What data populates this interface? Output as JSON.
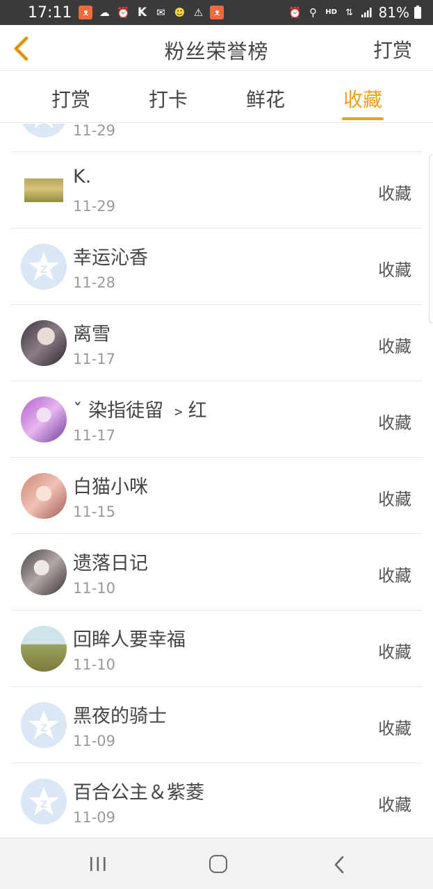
{
  "status_bar": {
    "time": "17:11",
    "battery_percent": "81%",
    "left_icons": [
      "app-notification-icon",
      "weather-icon",
      "alarm-icon",
      "k-app-icon",
      "mail-icon",
      "emoji-app-icon",
      "warning-icon",
      "app-notification-icon"
    ],
    "right_icons": [
      "alarm-icon",
      "location-icon",
      "hd-icon",
      "data-transfer-icon",
      "signal-icon",
      "battery-icon"
    ],
    "hd_label": "HD"
  },
  "header": {
    "title": "粉丝荣誉榜",
    "right_action": "打赏"
  },
  "tabs": [
    {
      "label": "打赏",
      "active": false
    },
    {
      "label": "打卡",
      "active": false
    },
    {
      "label": "鲜花",
      "active": false
    },
    {
      "label": "收藏",
      "active": true
    }
  ],
  "partial_row": {
    "date": "11-29"
  },
  "rows": [
    {
      "name": "K.",
      "date": "11-29",
      "action": "收藏",
      "avatar": "photo-landscape"
    },
    {
      "name": "幸运沁香",
      "date": "11-28",
      "action": "收藏",
      "avatar": "default"
    },
    {
      "name": "离雪",
      "date": "11-17",
      "action": "收藏",
      "avatar": "photo-dark"
    },
    {
      "name": "ˇ 染指徒留 ﹥红",
      "date": "11-17",
      "action": "收藏",
      "avatar": "photo-purple"
    },
    {
      "name": "白猫小咪",
      "date": "11-15",
      "action": "收藏",
      "avatar": "photo-pink"
    },
    {
      "name": "遗落日记",
      "date": "11-10",
      "action": "收藏",
      "avatar": "photo-gray"
    },
    {
      "name": "回眸人要幸福",
      "date": "11-10",
      "action": "收藏",
      "avatar": "photo-field"
    },
    {
      "name": "黑夜的骑士",
      "date": "11-09",
      "action": "收藏",
      "avatar": "default"
    },
    {
      "name": "百合公主＆紫菱",
      "date": "11-09",
      "action": "收藏",
      "avatar": "default"
    }
  ],
  "colors": {
    "accent": "#f2a016",
    "status_bar_bg": "#3a3a3a",
    "default_avatar_bg": "#dbe7f5"
  }
}
